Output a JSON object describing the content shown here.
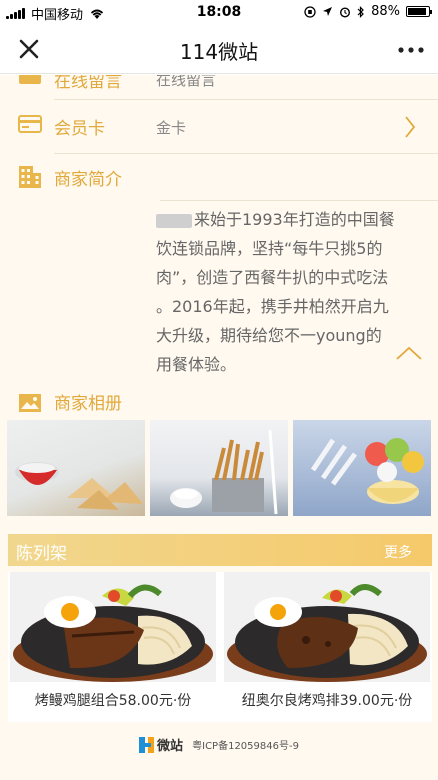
{
  "status_bar": {
    "carrier": "中国移动",
    "time": "18:08",
    "battery": "88%",
    "battery_level": 0.88
  },
  "nav": {
    "title": "114微站",
    "close_icon": "close-icon",
    "more_icon": "more-icon"
  },
  "rows": {
    "partial_label": "在线留言",
    "partial_value": "在线留言",
    "member_label": "会员卡",
    "member_value": "金卡",
    "intro_label": "商家简介",
    "album_label": "商家相册"
  },
  "intro": {
    "text_1": "来始于1993年打造的中国餐",
    "text_2": "饮连锁品牌，坚持“每牛只挑5的",
    "text_3": "肉”，创造了西餐牛扒的中式吃法",
    "text_4": "。2016年起，携手井柏然开启九",
    "text_5": "大升级，期待给您不一young的",
    "text_6": "用餐体验。"
  },
  "shelf": {
    "title": "陈列架",
    "more": "更多"
  },
  "products": [
    {
      "name": "烤鳗鸡腿组合58.00元·份"
    },
    {
      "name": "纽奥尔良烤鸡排39.00元·份"
    }
  ],
  "footer": {
    "logo_name": "微站",
    "logo_sub": "weizhan",
    "icp": "粤ICP备12059846号-9"
  },
  "colors": {
    "accent": "#e1a93b",
    "icon": "#e8b64a",
    "background": "#fff9f0",
    "shelf_bar": "#f1d78e"
  }
}
